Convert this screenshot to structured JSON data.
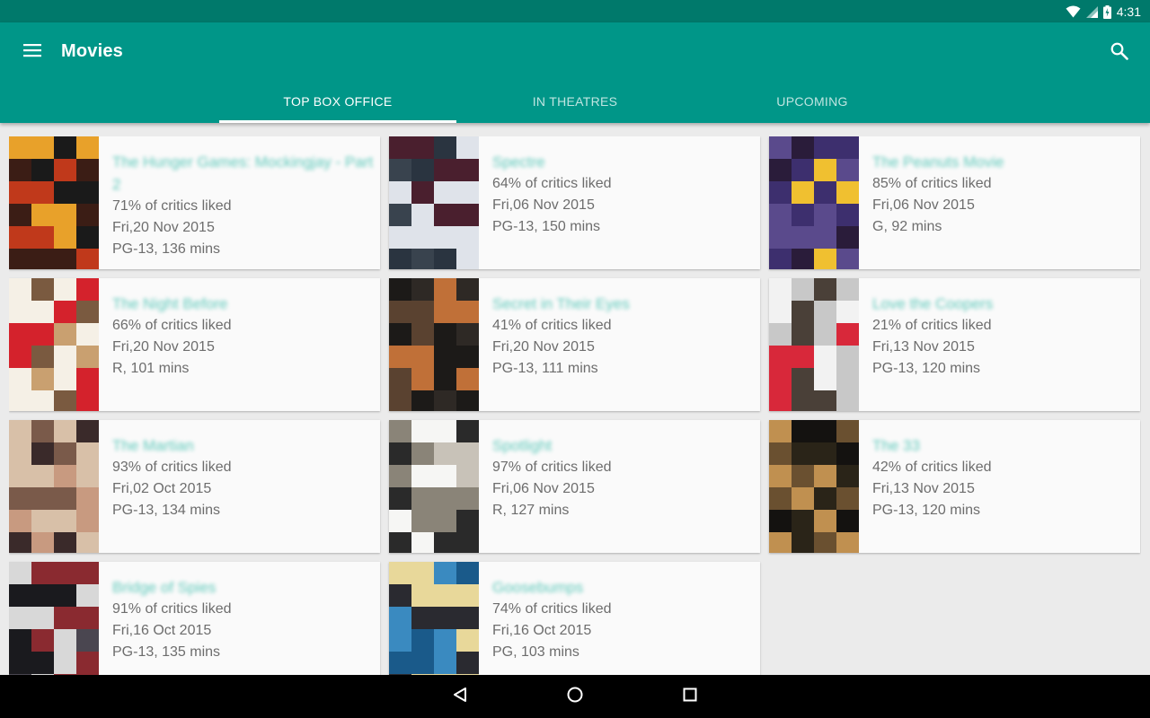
{
  "status_bar": {
    "time": "4:31"
  },
  "app": {
    "title": "Movies"
  },
  "tabs": [
    {
      "label": "TOP BOX OFFICE",
      "active": true
    },
    {
      "label": "IN THEATRES",
      "active": false
    },
    {
      "label": "UPCOMING",
      "active": false
    }
  ],
  "colors": {
    "status_bar": "#00796b",
    "app_bar": "#009688",
    "title_text": "#5fc9bb",
    "meta_text": "#6d6d6d"
  },
  "movies": [
    {
      "title": "The Hunger Games: Mockingjay - Part 2",
      "rating": "71% of critics liked",
      "release": "Fri,20 Nov 2015",
      "info": "PG-13, 136 mins",
      "poster_colors": [
        "#3b1d15",
        "#c0391b",
        "#e8a12a",
        "#1a1a1a"
      ]
    },
    {
      "title": "Spectre",
      "rating": "64% of critics liked",
      "release": "Fri,06 Nov 2015",
      "info": "PG-13, 150 mins",
      "poster_colors": [
        "#2a3440",
        "#dfe3ea",
        "#4a1f2e",
        "#39434e"
      ]
    },
    {
      "title": "The Peanuts Movie",
      "rating": "85% of critics liked",
      "release": "Fri,06 Nov 2015",
      "info": "G, 92 mins",
      "poster_colors": [
        "#3d2f6e",
        "#5a4a8c",
        "#2a1c3a",
        "#f0c030"
      ]
    },
    {
      "title": "The Night Before",
      "rating": "66% of critics liked",
      "release": "Fri,20 Nov 2015",
      "info": "R, 101 mins",
      "poster_colors": [
        "#d4222c",
        "#f5f0e6",
        "#c9a070",
        "#7a5a40"
      ]
    },
    {
      "title": "Secret in Their Eyes",
      "rating": "41% of critics liked",
      "release": "Fri,20 Nov 2015",
      "info": "PG-13, 111 mins",
      "poster_colors": [
        "#1c1a18",
        "#5a4230",
        "#c07038",
        "#2e2925"
      ]
    },
    {
      "title": "Love the Coopers",
      "rating": "21% of critics liked",
      "release": "Fri,13 Nov 2015",
      "info": "PG-13, 120 mins",
      "poster_colors": [
        "#f2f2f2",
        "#d8283a",
        "#4a4038",
        "#c8c8c8"
      ]
    },
    {
      "title": "The Martian",
      "rating": "93% of critics liked",
      "release": "Fri,02 Oct 2015",
      "info": "PG-13, 134 mins",
      "poster_colors": [
        "#7a5a4a",
        "#c89a80",
        "#3a2a2a",
        "#d8c0a8"
      ]
    },
    {
      "title": "Spotlight",
      "rating": "97% of critics liked",
      "release": "Fri,06 Nov 2015",
      "info": "R, 127 mins",
      "poster_colors": [
        "#f6f6f4",
        "#c8c2b8",
        "#2a2a2a",
        "#8a8478"
      ]
    },
    {
      "title": "The 33",
      "rating": "42% of critics liked",
      "release": "Fri,13 Nov 2015",
      "info": "PG-13, 120 mins",
      "poster_colors": [
        "#141210",
        "#6a5030",
        "#c09050",
        "#2a2418"
      ]
    },
    {
      "title": "Bridge of Spies",
      "rating": "91% of critics liked",
      "release": "Fri,16 Oct 2015",
      "info": "PG-13, 135 mins",
      "poster_colors": [
        "#1a1a1e",
        "#8a2a30",
        "#d8d8d8",
        "#4a4650"
      ]
    },
    {
      "title": "Goosebumps",
      "rating": "74% of critics liked",
      "release": "Fri,16 Oct 2015",
      "info": "PG, 103 mins",
      "poster_colors": [
        "#1a5a8a",
        "#e8d89a",
        "#3a8ac0",
        "#2a2a30"
      ]
    }
  ],
  "nav": {
    "back": "back-icon",
    "home": "home-icon",
    "recents": "recents-icon"
  }
}
